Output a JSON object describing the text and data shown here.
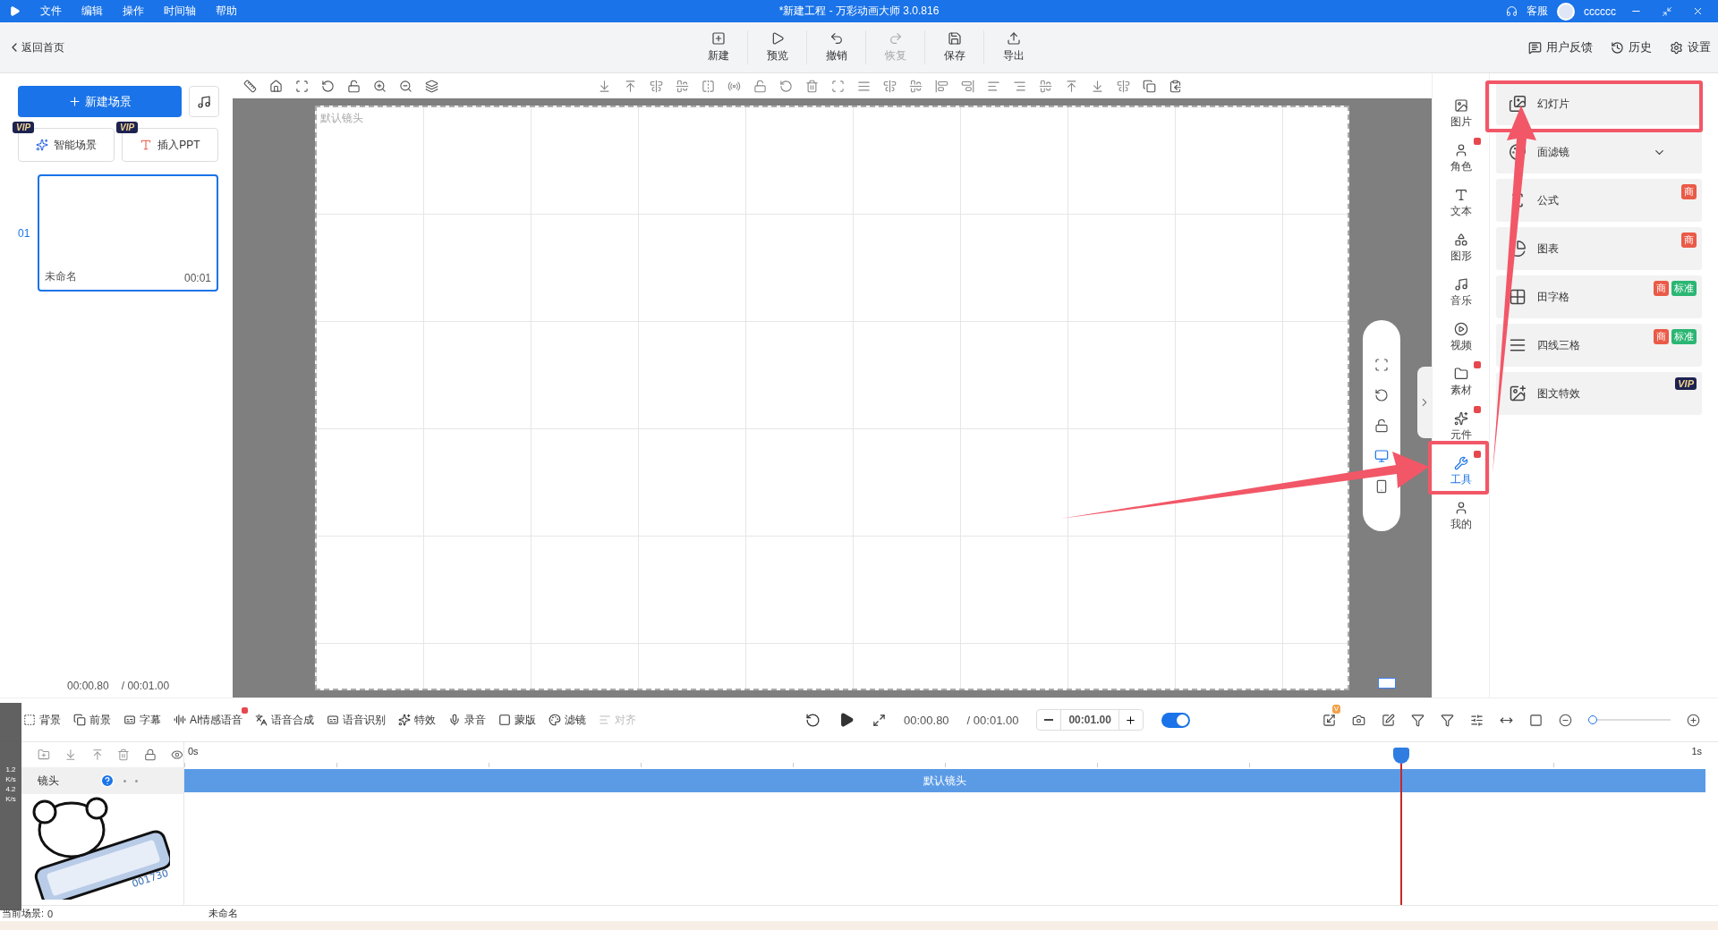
{
  "title_bar": {
    "menu": [
      "文件",
      "编辑",
      "操作",
      "时间轴",
      "帮助"
    ],
    "title": "*新建工程 - 万彩动画大师 3.0.816",
    "service": "客服",
    "user": "cccccc"
  },
  "top_bar": {
    "back": "返回首页",
    "actions": [
      {
        "label": "新建",
        "disabled": false
      },
      {
        "label": "预览",
        "disabled": false
      },
      {
        "label": "撤销",
        "disabled": false
      },
      {
        "label": "恢复",
        "disabled": true
      },
      {
        "label": "保存",
        "disabled": false
      },
      {
        "label": "导出",
        "disabled": false
      }
    ],
    "right": [
      "用户反馈",
      "历史",
      "设置"
    ]
  },
  "left_panel": {
    "new_scene": "新建场景",
    "extras": [
      {
        "label": "智能场景",
        "badge": "VIP"
      },
      {
        "label": "插入PPT",
        "badge": "VIP"
      }
    ],
    "scenes": [
      {
        "index": "01",
        "name": "未命名",
        "duration": "00:01",
        "selected": true
      }
    ],
    "current_time": "00:00.80",
    "total_time": "/ 00:01.00"
  },
  "canvas": {
    "camera_label": "默认镜头"
  },
  "icon_column": [
    {
      "label": "图片",
      "new": false,
      "selected": false
    },
    {
      "label": "角色",
      "new": true,
      "selected": false
    },
    {
      "label": "文本",
      "new": false,
      "selected": false
    },
    {
      "label": "图形",
      "new": false,
      "selected": false
    },
    {
      "label": "音乐",
      "new": false,
      "selected": false
    },
    {
      "label": "视频",
      "new": false,
      "selected": false
    },
    {
      "label": "素材",
      "new": true,
      "selected": false
    },
    {
      "label": "元件",
      "new": true,
      "selected": false
    },
    {
      "label": "工具",
      "new": true,
      "selected": true
    },
    {
      "label": "我的",
      "new": false,
      "selected": false
    }
  ],
  "tool_panel": [
    {
      "label": "幻灯片",
      "expandable": false
    },
    {
      "label": "面滤镜",
      "expandable": true
    },
    {
      "label": "公式",
      "expandable": false,
      "tags": [
        {
          "text": "商",
          "kind": "commercial"
        }
      ]
    },
    {
      "label": "图表",
      "expandable": false,
      "tags": [
        {
          "text": "商",
          "kind": "commercial"
        }
      ]
    },
    {
      "label": "田字格",
      "expandable": false,
      "tags": [
        {
          "text": "商",
          "kind": "commercial"
        },
        {
          "text": "标准",
          "kind": "standard"
        }
      ]
    },
    {
      "label": "四线三格",
      "expandable": false,
      "tags": [
        {
          "text": "商",
          "kind": "commercial"
        },
        {
          "text": "标准",
          "kind": "standard"
        }
      ]
    },
    {
      "label": "图文特效",
      "expandable": false,
      "tags": [
        {
          "text": "VIP",
          "kind": "vip"
        }
      ]
    }
  ],
  "bottom_toolbar": {
    "tools": [
      {
        "label": "背景",
        "disabled": false,
        "new": false
      },
      {
        "label": "前景",
        "disabled": false,
        "new": false
      },
      {
        "label": "字幕",
        "disabled": false,
        "new": false
      },
      {
        "label": "AI情感语音",
        "disabled": false,
        "new": true
      },
      {
        "label": "语音合成",
        "disabled": false,
        "new": false
      },
      {
        "label": "语音识别",
        "disabled": false,
        "new": false
      },
      {
        "label": "特效",
        "disabled": false,
        "new": false
      },
      {
        "label": "录音",
        "disabled": false,
        "new": false
      },
      {
        "label": "蒙版",
        "disabled": false,
        "new": false
      },
      {
        "label": "滤镜",
        "disabled": false,
        "new": false
      },
      {
        "label": "对齐",
        "disabled": true,
        "new": false
      }
    ],
    "current_time": "00:00.80",
    "total_time": "/ 00:01.00",
    "duration": "00:01.00",
    "snap_on": true,
    "badge": "V",
    "zoom": {
      "level": 0
    }
  },
  "timeline": {
    "ruler_start": "0s",
    "ruler_end": "1s",
    "tracks": [
      {
        "name": "镜头",
        "clip": "默认镜头"
      }
    ],
    "playhead": {
      "level": 0.8
    }
  },
  "status": {
    "label": "当前场景:",
    "value": "0",
    "scene": "未命名"
  },
  "net_speed": [
    {
      "value": "1.2",
      "unit": "K/s"
    },
    {
      "value": "4.2",
      "unit": "K/s"
    }
  ],
  "sticker": {
    "counter": "001730"
  }
}
